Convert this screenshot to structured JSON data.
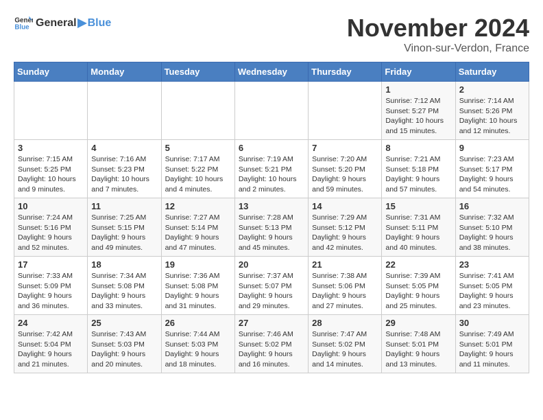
{
  "header": {
    "logo_general": "General",
    "logo_blue": "Blue",
    "title": "November 2024",
    "subtitle": "Vinon-sur-Verdon, France"
  },
  "weekdays": [
    "Sunday",
    "Monday",
    "Tuesday",
    "Wednesday",
    "Thursday",
    "Friday",
    "Saturday"
  ],
  "weeks": [
    [
      {
        "day": "",
        "detail": ""
      },
      {
        "day": "",
        "detail": ""
      },
      {
        "day": "",
        "detail": ""
      },
      {
        "day": "",
        "detail": ""
      },
      {
        "day": "",
        "detail": ""
      },
      {
        "day": "1",
        "detail": "Sunrise: 7:12 AM\nSunset: 5:27 PM\nDaylight: 10 hours and 15 minutes."
      },
      {
        "day": "2",
        "detail": "Sunrise: 7:14 AM\nSunset: 5:26 PM\nDaylight: 10 hours and 12 minutes."
      }
    ],
    [
      {
        "day": "3",
        "detail": "Sunrise: 7:15 AM\nSunset: 5:25 PM\nDaylight: 10 hours and 9 minutes."
      },
      {
        "day": "4",
        "detail": "Sunrise: 7:16 AM\nSunset: 5:23 PM\nDaylight: 10 hours and 7 minutes."
      },
      {
        "day": "5",
        "detail": "Sunrise: 7:17 AM\nSunset: 5:22 PM\nDaylight: 10 hours and 4 minutes."
      },
      {
        "day": "6",
        "detail": "Sunrise: 7:19 AM\nSunset: 5:21 PM\nDaylight: 10 hours and 2 minutes."
      },
      {
        "day": "7",
        "detail": "Sunrise: 7:20 AM\nSunset: 5:20 PM\nDaylight: 9 hours and 59 minutes."
      },
      {
        "day": "8",
        "detail": "Sunrise: 7:21 AM\nSunset: 5:18 PM\nDaylight: 9 hours and 57 minutes."
      },
      {
        "day": "9",
        "detail": "Sunrise: 7:23 AM\nSunset: 5:17 PM\nDaylight: 9 hours and 54 minutes."
      }
    ],
    [
      {
        "day": "10",
        "detail": "Sunrise: 7:24 AM\nSunset: 5:16 PM\nDaylight: 9 hours and 52 minutes."
      },
      {
        "day": "11",
        "detail": "Sunrise: 7:25 AM\nSunset: 5:15 PM\nDaylight: 9 hours and 49 minutes."
      },
      {
        "day": "12",
        "detail": "Sunrise: 7:27 AM\nSunset: 5:14 PM\nDaylight: 9 hours and 47 minutes."
      },
      {
        "day": "13",
        "detail": "Sunrise: 7:28 AM\nSunset: 5:13 PM\nDaylight: 9 hours and 45 minutes."
      },
      {
        "day": "14",
        "detail": "Sunrise: 7:29 AM\nSunset: 5:12 PM\nDaylight: 9 hours and 42 minutes."
      },
      {
        "day": "15",
        "detail": "Sunrise: 7:31 AM\nSunset: 5:11 PM\nDaylight: 9 hours and 40 minutes."
      },
      {
        "day": "16",
        "detail": "Sunrise: 7:32 AM\nSunset: 5:10 PM\nDaylight: 9 hours and 38 minutes."
      }
    ],
    [
      {
        "day": "17",
        "detail": "Sunrise: 7:33 AM\nSunset: 5:09 PM\nDaylight: 9 hours and 36 minutes."
      },
      {
        "day": "18",
        "detail": "Sunrise: 7:34 AM\nSunset: 5:08 PM\nDaylight: 9 hours and 33 minutes."
      },
      {
        "day": "19",
        "detail": "Sunrise: 7:36 AM\nSunset: 5:08 PM\nDaylight: 9 hours and 31 minutes."
      },
      {
        "day": "20",
        "detail": "Sunrise: 7:37 AM\nSunset: 5:07 PM\nDaylight: 9 hours and 29 minutes."
      },
      {
        "day": "21",
        "detail": "Sunrise: 7:38 AM\nSunset: 5:06 PM\nDaylight: 9 hours and 27 minutes."
      },
      {
        "day": "22",
        "detail": "Sunrise: 7:39 AM\nSunset: 5:05 PM\nDaylight: 9 hours and 25 minutes."
      },
      {
        "day": "23",
        "detail": "Sunrise: 7:41 AM\nSunset: 5:05 PM\nDaylight: 9 hours and 23 minutes."
      }
    ],
    [
      {
        "day": "24",
        "detail": "Sunrise: 7:42 AM\nSunset: 5:04 PM\nDaylight: 9 hours and 21 minutes."
      },
      {
        "day": "25",
        "detail": "Sunrise: 7:43 AM\nSunset: 5:03 PM\nDaylight: 9 hours and 20 minutes."
      },
      {
        "day": "26",
        "detail": "Sunrise: 7:44 AM\nSunset: 5:03 PM\nDaylight: 9 hours and 18 minutes."
      },
      {
        "day": "27",
        "detail": "Sunrise: 7:46 AM\nSunset: 5:02 PM\nDaylight: 9 hours and 16 minutes."
      },
      {
        "day": "28",
        "detail": "Sunrise: 7:47 AM\nSunset: 5:02 PM\nDaylight: 9 hours and 14 minutes."
      },
      {
        "day": "29",
        "detail": "Sunrise: 7:48 AM\nSunset: 5:01 PM\nDaylight: 9 hours and 13 minutes."
      },
      {
        "day": "30",
        "detail": "Sunrise: 7:49 AM\nSunset: 5:01 PM\nDaylight: 9 hours and 11 minutes."
      }
    ]
  ]
}
